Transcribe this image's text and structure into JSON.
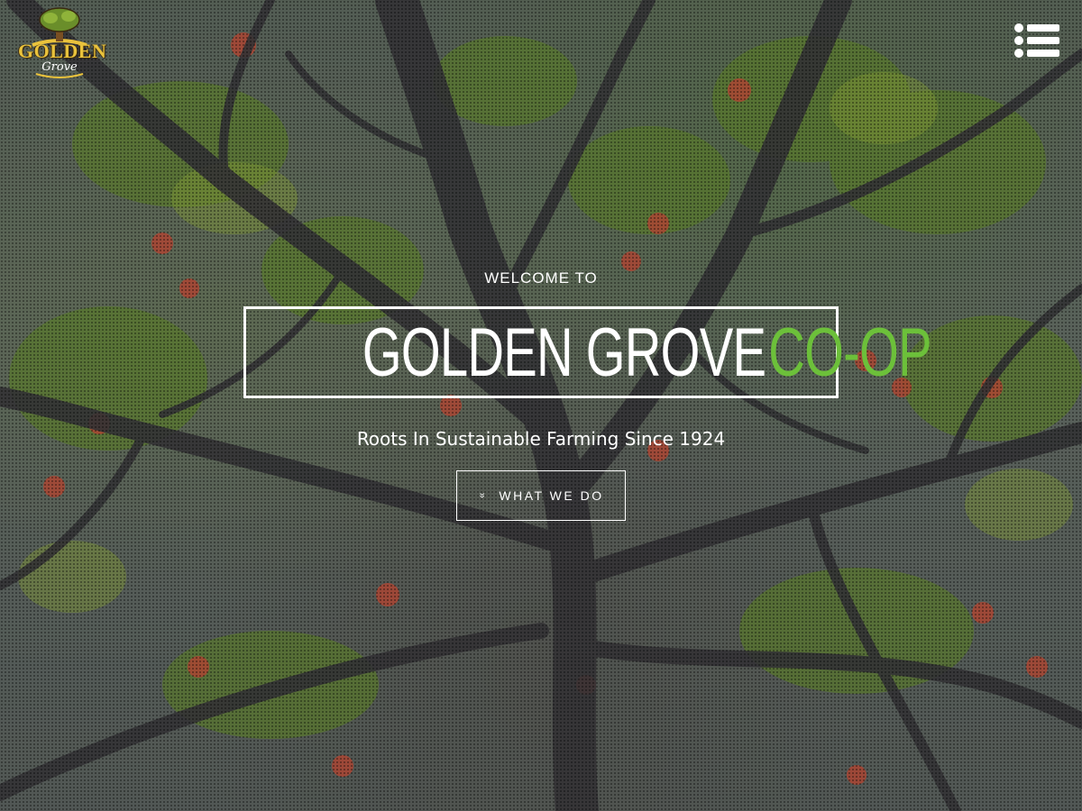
{
  "logo": {
    "brand_word": "GOLDEN",
    "script_word": "Grove"
  },
  "menu": {
    "icon": "hamburger-list-icon"
  },
  "hero": {
    "welcome": "WELCOME TO",
    "title_main": "GOLDEN GROVE",
    "title_accent": "CO-OP",
    "tagline": "Roots In Sustainable Farming Since 1924",
    "cta_label": "WHAT WE DO",
    "cta_icon": "double-chevron-down-icon",
    "cta_icon_glyph": "»"
  },
  "colors": {
    "accent_green": "#6cc03a",
    "logo_gold": "#e9c23c",
    "text": "#ffffff"
  }
}
